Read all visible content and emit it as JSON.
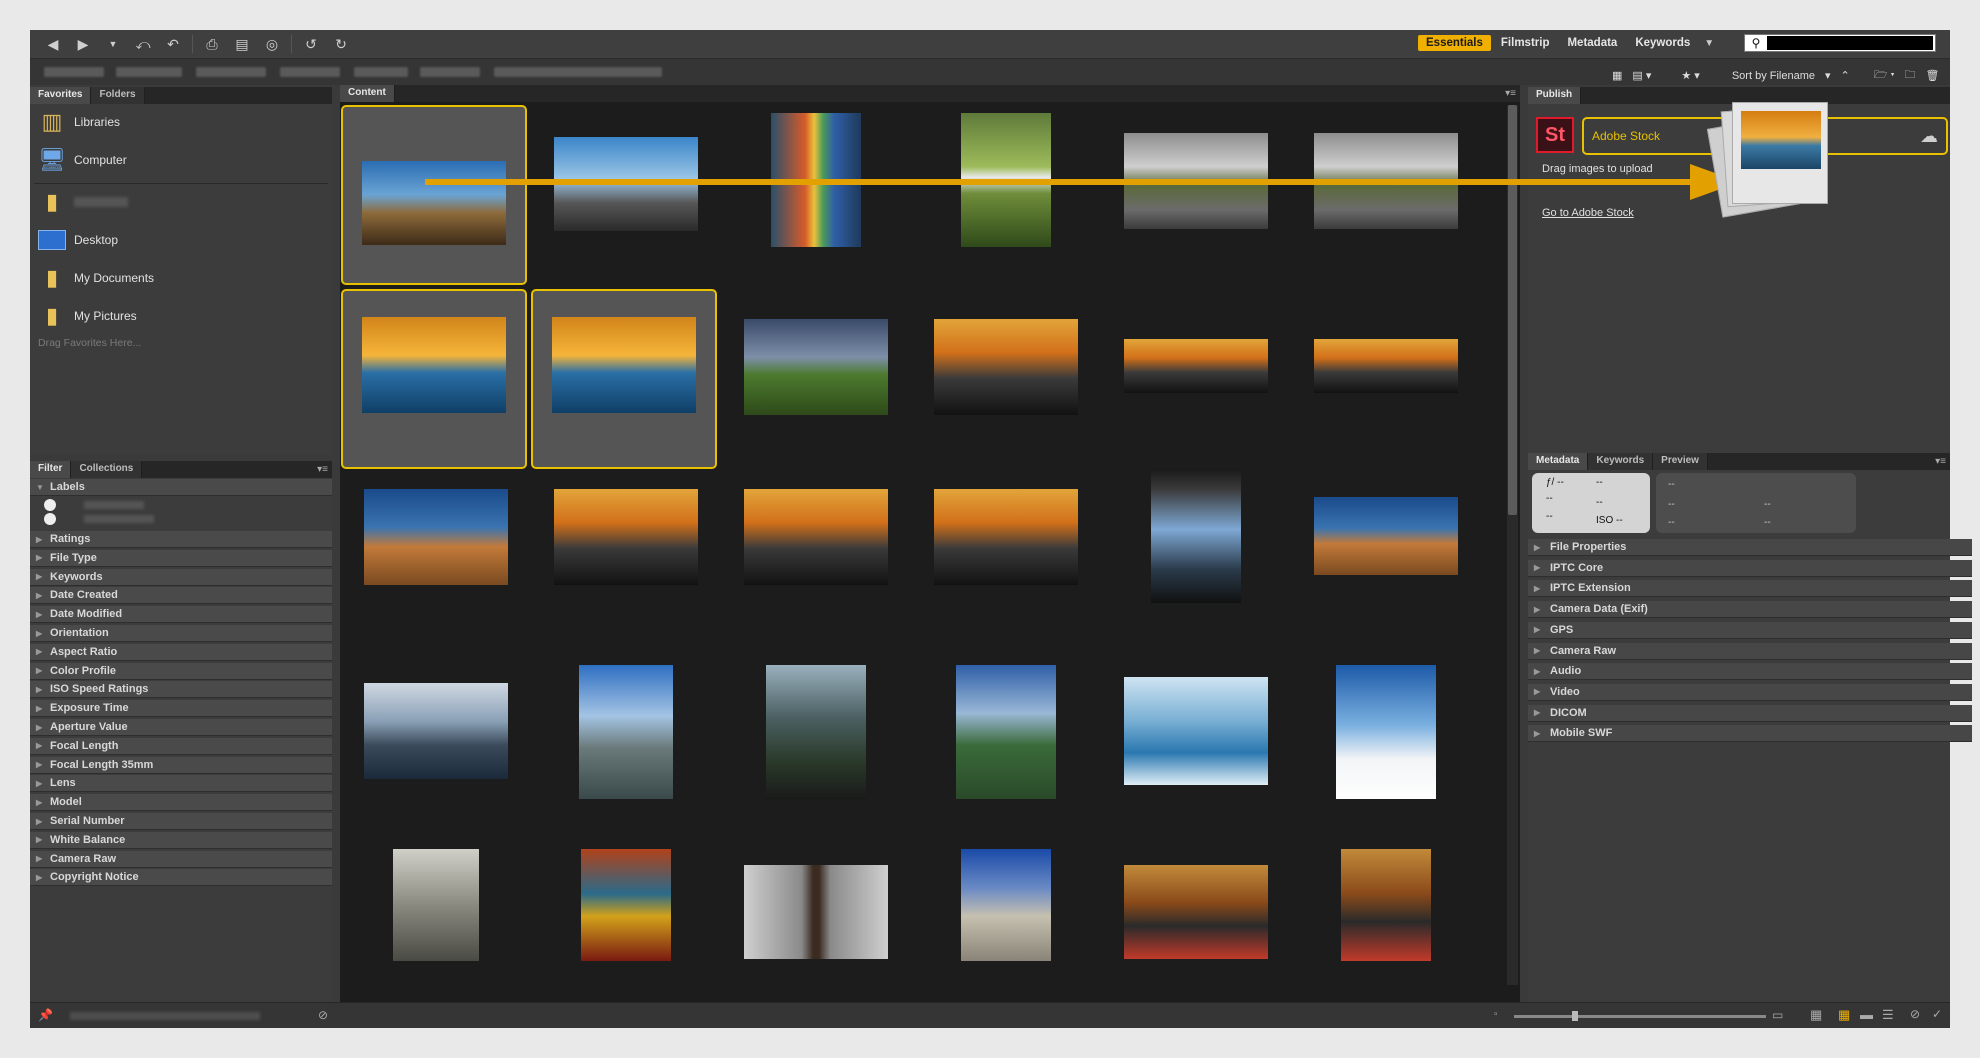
{
  "workspaces": {
    "tabs": [
      "Essentials",
      "Filmstrip",
      "Metadata",
      "Keywords"
    ],
    "active": "Essentials"
  },
  "pathbar": {
    "sort_label": "Sort by Filename"
  },
  "favorites_panel": {
    "tabs": [
      "Favorites",
      "Folders"
    ],
    "items": [
      {
        "label": "Libraries",
        "icon": "libraries-icon"
      },
      {
        "label": "Computer",
        "icon": "computer-icon"
      },
      {
        "label": "",
        "icon": "folder-icon"
      },
      {
        "label": "Desktop",
        "icon": "desktop-icon"
      },
      {
        "label": "My Documents",
        "icon": "documents-folder-icon"
      },
      {
        "label": "My Pictures",
        "icon": "pictures-folder-icon"
      }
    ],
    "hint": "Drag Favorites Here..."
  },
  "filter_panel": {
    "tabs": [
      "Filter",
      "Collections"
    ],
    "items": [
      "Labels",
      "Ratings",
      "File Type",
      "Keywords",
      "Date Created",
      "Date Modified",
      "Orientation",
      "Aspect Ratio",
      "Color Profile",
      "ISO Speed Ratings",
      "Exposure Time",
      "Aperture Value",
      "Focal Length",
      "Focal Length 35mm",
      "Lens",
      "Model",
      "Serial Number",
      "White Balance",
      "Camera Raw",
      "Copyright Notice"
    ]
  },
  "content_panel": {
    "tab": "Content"
  },
  "publish_panel": {
    "tab": "Publish",
    "service": "Adobe Stock",
    "logo_text": "St",
    "drag_hint": "Drag images to upload",
    "link": "Go to Adobe Stock"
  },
  "metadata_panel": {
    "tabs": [
      "Metadata",
      "Keywords",
      "Preview"
    ],
    "placard": {
      "aperture": "ƒ/ --",
      "shutter": "--",
      "dash": "--",
      "iso": "ISO --"
    },
    "sections": [
      "File Properties",
      "IPTC Core",
      "IPTC Extension",
      "Camera Data (Exif)",
      "GPS",
      "Camera Raw",
      "Audio",
      "Video",
      "DICOM",
      "Mobile SWF"
    ]
  },
  "colors": {
    "accent": "#e8c100",
    "essentials_active": "#f0b000",
    "adobe_stock_red": "#e0192b"
  }
}
